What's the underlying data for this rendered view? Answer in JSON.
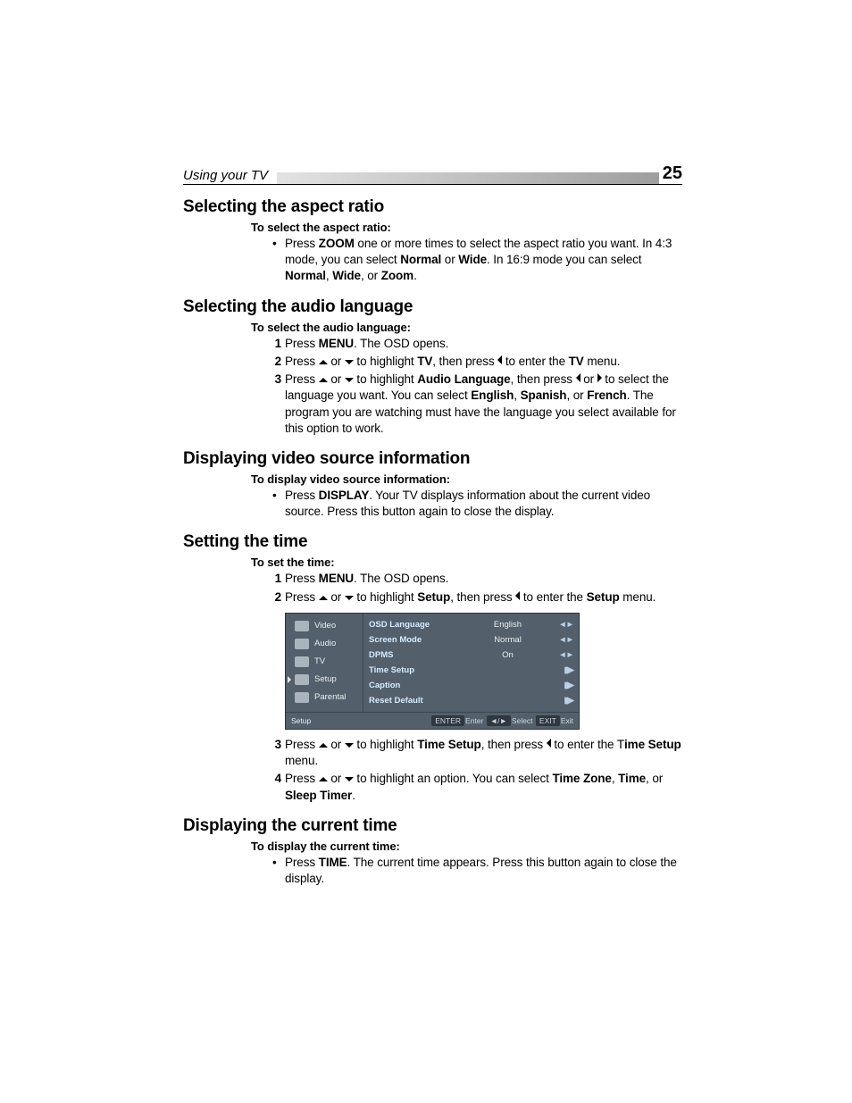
{
  "header": {
    "running": "Using your TV",
    "page": "25"
  },
  "s1": {
    "h": "Selecting the aspect ratio",
    "intro": "To select the aspect ratio:",
    "b1a": "Press ",
    "b1b": "ZOOM",
    "b1c": " one or more times to select the aspect ratio you want. In 4:3 mode, you can select ",
    "b1d": "Normal",
    "b1e": " or ",
    "b1f": "Wide",
    "b1g": ". In 16:9 mode you can select ",
    "b1h": "Normal",
    "b1i": ", ",
    "b1j": "Wide",
    "b1k": ", or ",
    "b1l": "Zoom",
    "b1m": "."
  },
  "s2": {
    "h": "Selecting the audio language",
    "intro": "To select the audio language:",
    "l1a": "Press ",
    "l1b": "MENU",
    "l1c": ". The OSD opens.",
    "l2a": "Press ",
    "l2b": " or ",
    "l2c": " to highlight ",
    "l2d": "TV",
    "l2e": ", then press ",
    "l2f": " to enter the ",
    "l2g": "TV",
    "l2h": " menu.",
    "l3a": "Press ",
    "l3b": " or ",
    "l3c": " to highlight ",
    "l3d": "Audio Language",
    "l3e": ", then press ",
    "l3f": " or ",
    "l3g": " to select the language you want. You can select ",
    "l3h": "English",
    "l3i": ", ",
    "l3j": "Spanish",
    "l3k": ", or ",
    "l3l": "French",
    "l3m": ". The program you are watching must have the language you select available for this option to work."
  },
  "s3": {
    "h": "Displaying video source information",
    "intro": "To display video source information:",
    "b1a": "Press ",
    "b1b": "DISPLAY",
    "b1c": ". Your TV displays information about the current video source. Press this button again to close the display."
  },
  "s4": {
    "h": "Setting the time",
    "intro": "To set the time:",
    "l1a": "Press ",
    "l1b": "MENU",
    "l1c": ". The OSD opens.",
    "l2a": "Press ",
    "l2b": " or ",
    "l2c": " to highlight ",
    "l2d": "Setup",
    "l2e": ", then press ",
    "l2f": " to enter the ",
    "l2g": "Setup",
    "l2h": " menu.",
    "l3a": "Press ",
    "l3b": " or ",
    "l3c": " to highlight ",
    "l3d": "Time Setup",
    "l3e": ", then press ",
    "l3f": " to enter the T",
    "l3g": "ime Setup",
    "l3h": " menu.",
    "l4a": "Press ",
    "l4b": " or ",
    "l4c": " to highlight an option. You can select ",
    "l4d": "Time Zone",
    "l4e": ", ",
    "l4f": "Time",
    "l4g": ", or ",
    "l4h": "Sleep Timer",
    "l4i": "."
  },
  "osd": {
    "side": {
      "video": "Video",
      "audio": "Audio",
      "tv": "TV",
      "setup": "Setup",
      "parental": "Parental"
    },
    "rows": {
      "r1l": "OSD Language",
      "r1v": "English",
      "r1c": "◄►",
      "r2l": "Screen Mode",
      "r2v": "Normal",
      "r2c": "◄►",
      "r3l": "DPMS",
      "r3v": "On",
      "r3c": "◄►",
      "r4l": "Time Setup",
      "r4v": "",
      "r4c": "▮▶",
      "r5l": "Caption",
      "r5v": "",
      "r5c": "▮▶",
      "r6l": "Reset Default",
      "r6v": "",
      "r6c": "▮▶"
    },
    "footer": {
      "crumb": "Setup",
      "enterTag": "ENTER",
      "enterTxt": "Enter",
      "selIcon": "◄/►",
      "selTxt": "Select",
      "exitTag": "EXIT",
      "exitTxt": "Exit"
    }
  },
  "s5": {
    "h": "Displaying the current time",
    "intro": "To display the current time:",
    "b1a": "Press ",
    "b1b": "TIME",
    "b1c": ". The current time appears. Press this button again to close the display."
  }
}
